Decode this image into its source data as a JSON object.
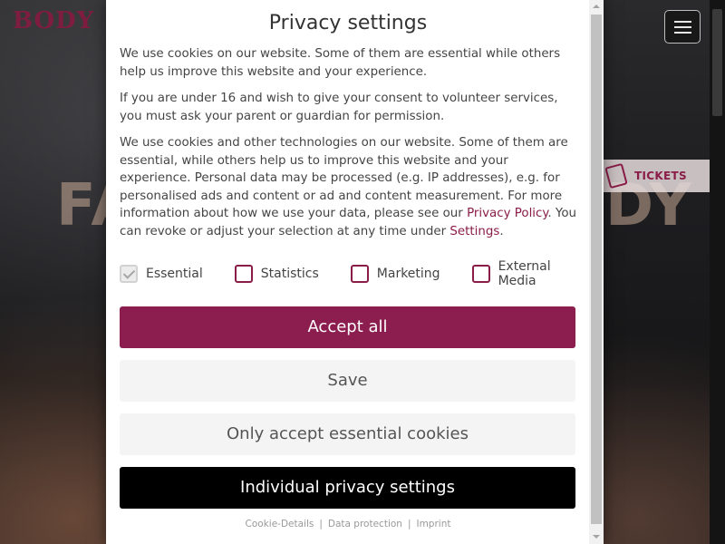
{
  "background": {
    "logo": "BODY",
    "hero_left": "FA",
    "hero_right": "DY",
    "tickets_label": "TICKETS"
  },
  "modal": {
    "title": "Privacy settings",
    "paragraphs": [
      "We use cookies on our website. Some of them are essential while others help us improve this website and your experience.",
      "If you are under 16 and wish to give your consent to volunteer services, you must ask your parent or guardian for permission."
    ],
    "para3": {
      "text_before": "We use cookies and other technologies on our website. Some of them are essential, while others help us to improve this website and your experience. Personal data may be processed (e.g. IP addresses), e.g. for personalised ads and content or ad and content measurement. For more information about how we use your data, please see our ",
      "privacy_link": "Privacy Policy",
      "text_middle": ". You can revoke or adjust your selection at any time under ",
      "settings_link": "Settings",
      "text_after": "."
    },
    "checkboxes": [
      {
        "label": "Essential",
        "checked": true,
        "disabled": true
      },
      {
        "label": "Statistics",
        "checked": false
      },
      {
        "label": "Marketing",
        "checked": false
      },
      {
        "label": "External Media",
        "checked": false
      }
    ],
    "buttons": {
      "accept_all": "Accept all",
      "save": "Save",
      "essential_only": "Only accept essential cookies",
      "individual": "Individual privacy settings"
    },
    "footer": {
      "cookie_details": "Cookie-Details",
      "data_protection": "Data protection",
      "imprint": "Imprint",
      "separator": "|"
    }
  },
  "colors": {
    "accent": "#8c1d4f",
    "individual_button": "#000000",
    "neutral_button": "#f4f4f4"
  }
}
